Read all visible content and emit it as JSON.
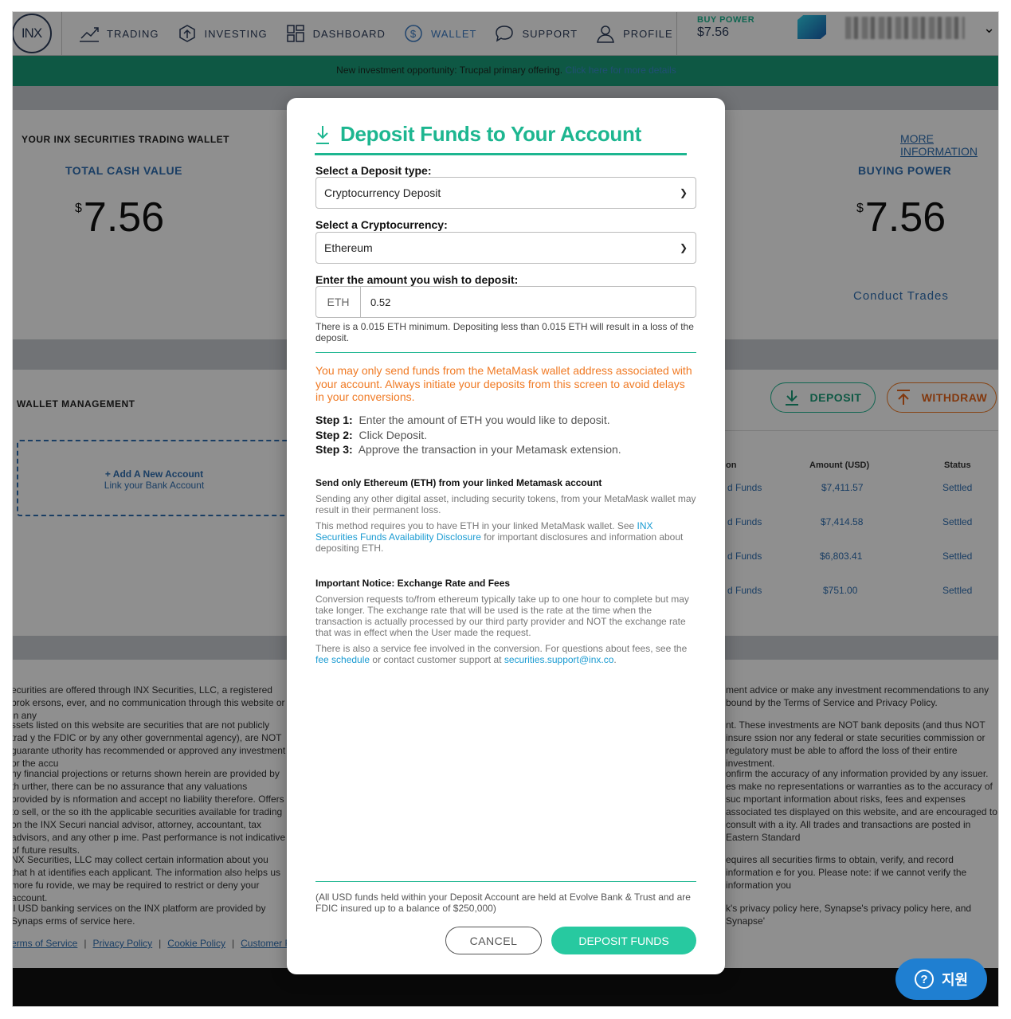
{
  "nav": {
    "logo": "INX",
    "items": [
      {
        "label": "TRADING"
      },
      {
        "label": "INVESTING"
      },
      {
        "label": "DASHBOARD"
      },
      {
        "label": "WALLET"
      },
      {
        "label": "SUPPORT"
      },
      {
        "label": "PROFILE"
      }
    ],
    "buy_power_label": "BUY POWER",
    "buy_power_value": "$7.56"
  },
  "banner": {
    "text": "New investment opportunity: Trucpal primary offering.",
    "link": "Click here for more details"
  },
  "wallet": {
    "title": "YOUR INX SECURITIES TRADING WALLET",
    "more_info": "MORE INFORMATION",
    "total_cash_label": "TOTAL CASH VALUE",
    "total_cash_currency": "$",
    "total_cash_value": "7.56",
    "buying_power_label": "BUYING POWER",
    "buying_power_currency": "$",
    "buying_power_value": "7.56",
    "conduct_trades": "Conduct Trades"
  },
  "management": {
    "title": "WALLET MANAGEMENT",
    "deposit_button": "DEPOSIT",
    "withdraw_button": "WITHDRAW",
    "add_account": "+ Add A New Account",
    "add_account_sub": "Link your Bank Account",
    "columns": {
      "type": "on",
      "amount": "Amount (USD)",
      "status": "Status"
    },
    "rows": [
      {
        "type": "d Funds",
        "amount": "$7,411.57",
        "status": "Settled"
      },
      {
        "type": "d Funds",
        "amount": "$7,414.58",
        "status": "Settled"
      },
      {
        "type": "d Funds",
        "amount": "$6,803.41",
        "status": "Settled"
      },
      {
        "type": "d Funds",
        "amount": "$751.00",
        "status": "Settled"
      }
    ]
  },
  "footer": {
    "left": [
      "ecurities are offered through INX Securities, LLC, a registered brok ersons, ever, and no communication through this website or in any",
      "ssets listed on this website are securities that are not publicly trad y the FDIC or by any other governmental agency), are NOT guarante uthority has recommended or approved any investment or the accu",
      "ny financial projections or returns shown herein are provided by th urther, there can be no assurance that any valuations provided by is nformation and accept no liability therefore. Offers to sell, or the so ith the applicable securities available for trading on the INX Securi nancial advisor, attorney, accountant, tax advisors, and any other p ime. Past performance is not indicative of future results.",
      "NX Securities, LLC may collect certain information about you that h at identifies each applicant. The information also helps us more fu rovide, we may be required to restrict or deny your account.",
      "ll USD banking services on the INX platform are provided by Synaps erms of service here."
    ],
    "right": [
      "ment advice or make any investment recommendations to any bound by the Terms of Service and Privacy Policy.",
      "nt. These investments are NOT bank deposits (and thus NOT insure ssion nor any federal or state securities commission or regulatory must be able to afford the loss of their entire investment.",
      "onfirm the accuracy of any information provided by any issuer. es make no representations or warranties as to the accuracy of suc mportant information about risks, fees and expenses associated tes displayed on this website, and are encouraged to consult with a ity. All trades and transactions are posted in Eastern Standard",
      "equires all securities firms to obtain, verify, and record information e for you. Please note: if we cannot verify the information you",
      "k's privacy policy here, Synapse's privacy policy here, and Synapse'"
    ],
    "links": [
      "erms of Service",
      "Privacy Policy",
      "Cookie Policy",
      "Customer Rel"
    ]
  },
  "help_button": "지원",
  "modal": {
    "title": "Deposit Funds to Your Account",
    "deposit_type_label": "Select a Deposit type:",
    "deposit_type_value": "Cryptocurrency Deposit",
    "crypto_label": "Select a Cryptocurrency:",
    "crypto_value": "Ethereum",
    "amount_label": "Enter the amount you wish to deposit:",
    "amount_prefix": "ETH",
    "amount_value": "0.52",
    "minimum_note": "There is a 0.015 ETH minimum. Depositing less than 0.015 ETH will result in a loss of the deposit.",
    "warning": "You may only send funds from the MetaMask wallet address associated with your account. Always initiate your deposits from this screen to avoid delays in your conversions.",
    "steps": [
      {
        "label": "Step 1:",
        "text": "Enter the amount of ETH you would like to deposit."
      },
      {
        "label": "Step 2:",
        "text": "Click Deposit."
      },
      {
        "label": "Step 3:",
        "text": "Approve the transaction in your Metamask extension."
      }
    ],
    "send_heading": "Send only Ethereum (ETH) from your linked Metamask account",
    "send_p1": "Sending any other digital asset, including security tokens, from your MetaMask wallet may result in their permanent loss.",
    "send_p2_a": "This method requires you to have ETH in your linked MetaMask wallet. See",
    "send_p2_link": "INX Securities Funds Availability Disclosure",
    "send_p2_b": "for important disclosures and information about depositing ETH.",
    "notice_heading": "Important Notice: Exchange Rate and Fees",
    "notice_p1": "Conversion requests to/from ethereum typically take up to one hour to complete but may take longer. The exchange rate that will be used is the rate at the time when the transaction is actually processed by our third party provider and NOT the exchange rate that was in effect when the User made the request.",
    "notice_p2_a": "There is also a service fee involved in the conversion. For questions about fees, see the",
    "notice_p2_link": "fee schedule",
    "notice_p2_b": "or contact customer support at",
    "notice_p2_email": "securities.support@inx.co",
    "notice_p2_end": ".",
    "fdic_note": "(All USD funds held within your Deposit Account are held at Evolve Bank & Trust and are FDIC insured up to a balance of $250,000)",
    "cancel_button": "CANCEL",
    "deposit_button": "DEPOSIT FUNDS"
  },
  "colors": {
    "accent": "#1db690",
    "warning": "#f07a24",
    "link": "#1a9bd2",
    "nav": "#2b3c5a"
  }
}
